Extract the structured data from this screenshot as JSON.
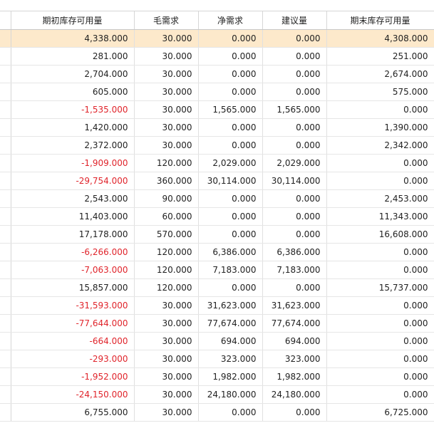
{
  "columns": [
    "期初库存可用量",
    "毛需求",
    "净需求",
    "建议量",
    "期末库存可用量"
  ],
  "selected_row_index": 0,
  "rows": [
    {
      "opening": "4,338.000",
      "gross": "30.000",
      "net": "0.000",
      "suggested": "0.000",
      "closing": "4,308.000"
    },
    {
      "opening": "281.000",
      "gross": "30.000",
      "net": "0.000",
      "suggested": "0.000",
      "closing": "251.000"
    },
    {
      "opening": "2,704.000",
      "gross": "30.000",
      "net": "0.000",
      "suggested": "0.000",
      "closing": "2,674.000"
    },
    {
      "opening": "605.000",
      "gross": "30.000",
      "net": "0.000",
      "suggested": "0.000",
      "closing": "575.000"
    },
    {
      "opening": "-1,535.000",
      "gross": "30.000",
      "net": "1,565.000",
      "suggested": "1,565.000",
      "closing": "0.000"
    },
    {
      "opening": "1,420.000",
      "gross": "30.000",
      "net": "0.000",
      "suggested": "0.000",
      "closing": "1,390.000"
    },
    {
      "opening": "2,372.000",
      "gross": "30.000",
      "net": "0.000",
      "suggested": "0.000",
      "closing": "2,342.000"
    },
    {
      "opening": "-1,909.000",
      "gross": "120.000",
      "net": "2,029.000",
      "suggested": "2,029.000",
      "closing": "0.000"
    },
    {
      "opening": "-29,754.000",
      "gross": "360.000",
      "net": "30,114.000",
      "suggested": "30,114.000",
      "closing": "0.000"
    },
    {
      "opening": "2,543.000",
      "gross": "90.000",
      "net": "0.000",
      "suggested": "0.000",
      "closing": "2,453.000"
    },
    {
      "opening": "11,403.000",
      "gross": "60.000",
      "net": "0.000",
      "suggested": "0.000",
      "closing": "11,343.000"
    },
    {
      "opening": "17,178.000",
      "gross": "570.000",
      "net": "0.000",
      "suggested": "0.000",
      "closing": "16,608.000"
    },
    {
      "opening": "-6,266.000",
      "gross": "120.000",
      "net": "6,386.000",
      "suggested": "6,386.000",
      "closing": "0.000"
    },
    {
      "opening": "-7,063.000",
      "gross": "120.000",
      "net": "7,183.000",
      "suggested": "7,183.000",
      "closing": "0.000"
    },
    {
      "opening": "15,857.000",
      "gross": "120.000",
      "net": "0.000",
      "suggested": "0.000",
      "closing": "15,737.000"
    },
    {
      "opening": "-31,593.000",
      "gross": "30.000",
      "net": "31,623.000",
      "suggested": "31,623.000",
      "closing": "0.000"
    },
    {
      "opening": "-77,644.000",
      "gross": "30.000",
      "net": "77,674.000",
      "suggested": "77,674.000",
      "closing": "0.000"
    },
    {
      "opening": "-664.000",
      "gross": "30.000",
      "net": "694.000",
      "suggested": "694.000",
      "closing": "0.000"
    },
    {
      "opening": "-293.000",
      "gross": "30.000",
      "net": "323.000",
      "suggested": "323.000",
      "closing": "0.000"
    },
    {
      "opening": "-1,952.000",
      "gross": "30.000",
      "net": "1,982.000",
      "suggested": "1,982.000",
      "closing": "0.000"
    },
    {
      "opening": "-24,150.000",
      "gross": "30.000",
      "net": "24,180.000",
      "suggested": "24,180.000",
      "closing": "0.000"
    },
    {
      "opening": "6,755.000",
      "gross": "30.000",
      "net": "0.000",
      "suggested": "0.000",
      "closing": "6,725.000"
    }
  ],
  "colors": {
    "negative_text": "#e0242b",
    "selected_row_bg": "#fde9cb",
    "normal_text": "#222222",
    "grid_line": "#e0e0e0"
  }
}
